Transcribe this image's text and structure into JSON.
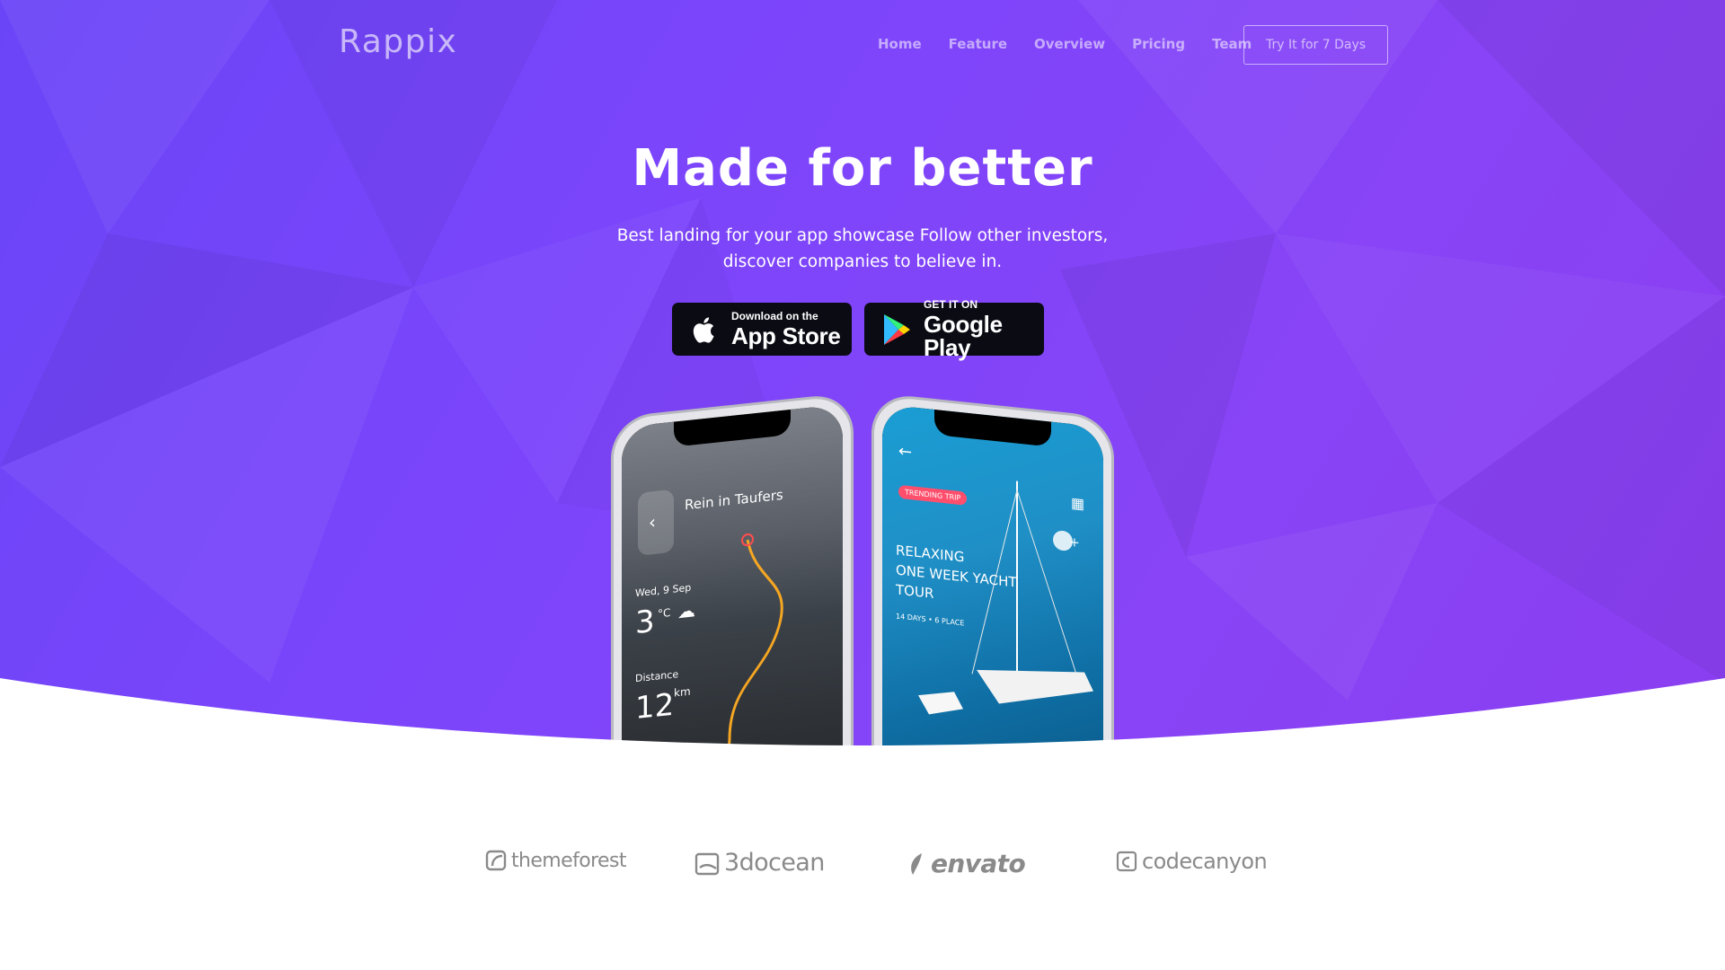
{
  "brand": {
    "logo": "Rappix"
  },
  "nav": {
    "items": [
      "Home",
      "Feature",
      "Overview",
      "Pricing",
      "Team"
    ],
    "cta": "Try It for 7 Days"
  },
  "hero": {
    "title": "Made for better",
    "subtitle_line1": "Best landing for your app showcase Follow other investors,",
    "subtitle_line2": "discover companies to believe in."
  },
  "stores": {
    "apple": {
      "small": "Download on the",
      "big": "App Store",
      "icon": "apple-icon"
    },
    "google": {
      "small": "GET IT ON",
      "big": "Google Play",
      "icon": "google-play-icon"
    }
  },
  "phone_left": {
    "title": "Rein in Taufers",
    "date": "Wed, 9 Sep",
    "temp": "3",
    "temp_unit": "°C",
    "distance_label": "Distance",
    "distance": "12",
    "distance_unit": "km"
  },
  "phone_right": {
    "badge": "TRENDING TRIP",
    "headline": [
      "RELAXING",
      "ONE WEEK YACHT",
      "TOUR"
    ],
    "meta": "14 DAYS • 6 PLACE"
  },
  "partners": [
    "themeforest",
    "3docean",
    "envato",
    "codecanyon"
  ],
  "colors": {
    "hero_start": "#6a45f7",
    "hero_end": "#8a3ef0",
    "store_bg": "#0b0b14",
    "partner_text": "#8a8a8a"
  }
}
